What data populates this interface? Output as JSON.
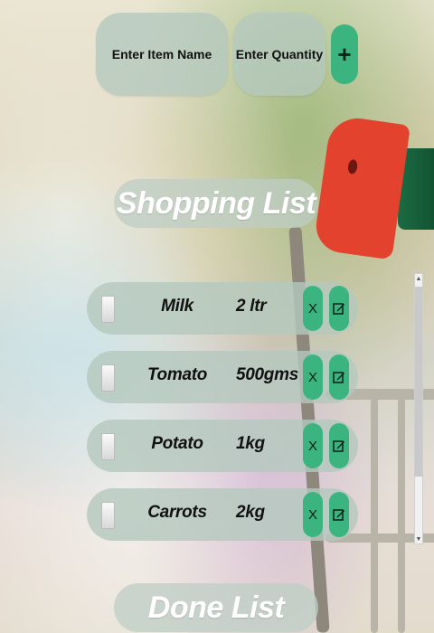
{
  "inputs": {
    "item_placeholder": "Enter Item Name",
    "quantity_placeholder": "Enter Quantity",
    "add_label": "+"
  },
  "shopping_list_title": "Shopping List",
  "done_list_title": "Done List",
  "items": [
    {
      "name": "Milk",
      "quantity": "2 ltr",
      "checked": false
    },
    {
      "name": "Tomato",
      "quantity": "500gms",
      "checked": false
    },
    {
      "name": "Potato",
      "quantity": "1kg",
      "checked": false
    },
    {
      "name": "Carrots",
      "quantity": "2kg",
      "checked": false
    }
  ],
  "buttons": {
    "delete_label": "X",
    "edit_icon": "edit-icon"
  },
  "colors": {
    "accent": "#3bb47f",
    "pill": "#b4c8be"
  }
}
